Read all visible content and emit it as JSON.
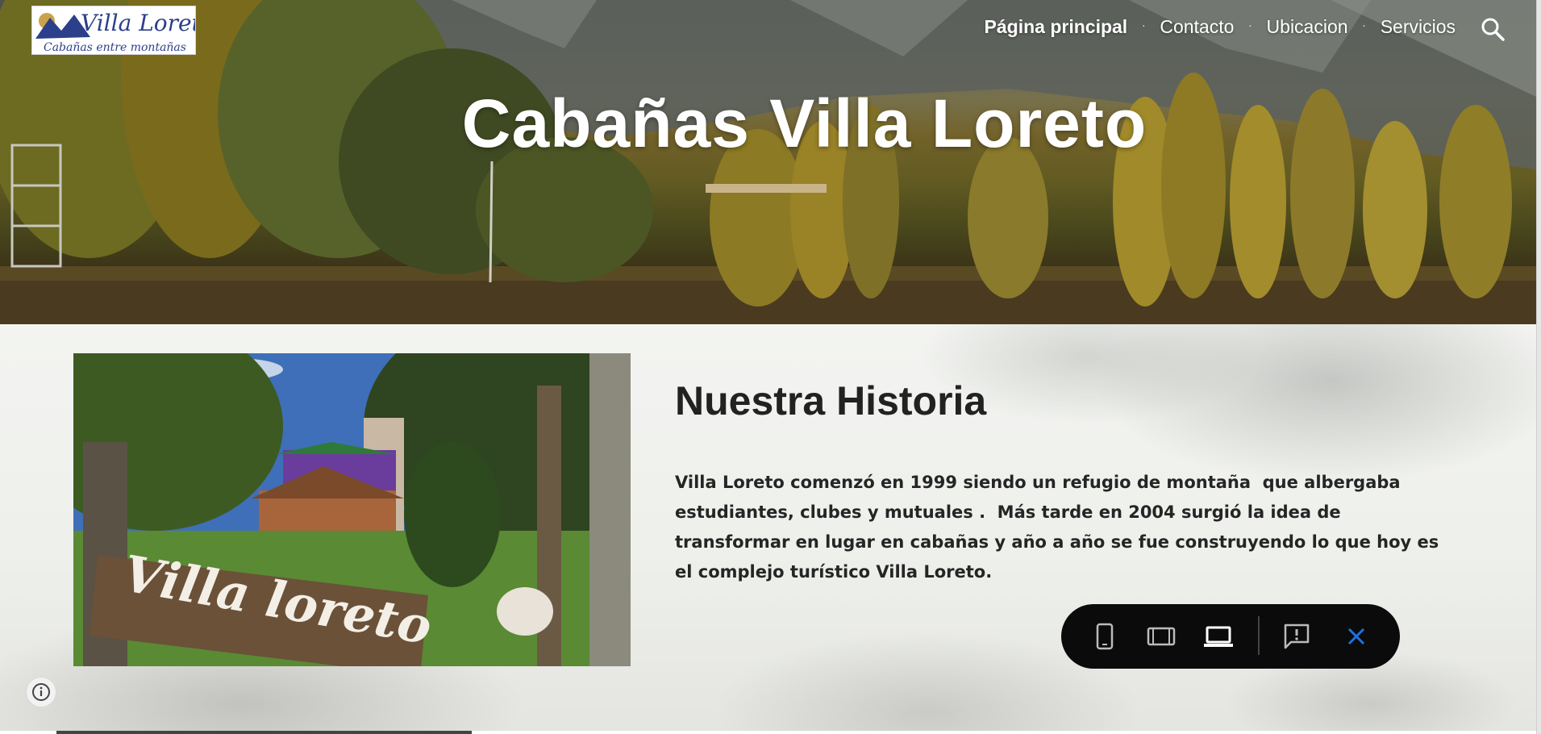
{
  "site": {
    "logo_text": "Villa Loreto",
    "logo_tagline": "Cabañas entre montañas"
  },
  "nav": {
    "items": [
      {
        "label": "Página principal",
        "active": true
      },
      {
        "label": "Contacto",
        "active": false
      },
      {
        "label": "Ubicacion",
        "active": false
      },
      {
        "label": "Servicios",
        "active": false
      }
    ],
    "search_icon": "search-icon"
  },
  "hero": {
    "title": "Cabañas Villa Loreto",
    "accent_color": "#c9b48a"
  },
  "section": {
    "title": "Nuestra Historia",
    "body": "Villa Loreto comenzó en 1999 siendo un refugio de montaña  que albergaba estudiantes, clubes y mutuales .  Más tarde en 2004 surgió la idea de transformar en lugar en cabañas y año a año se fue construyendo lo que hoy es el complejo turístico Villa Loreto.",
    "photo_sign_text": "Villa loreto"
  },
  "preview_toolbar": {
    "buttons": [
      {
        "icon": "phone-icon",
        "selected": false
      },
      {
        "icon": "tablet-icon",
        "selected": false
      },
      {
        "icon": "laptop-icon",
        "selected": true
      },
      {
        "icon": "report-icon",
        "selected": false
      },
      {
        "icon": "close-icon",
        "selected": false
      }
    ],
    "close_color": "#1a73e8"
  },
  "info_icon": "info-icon"
}
